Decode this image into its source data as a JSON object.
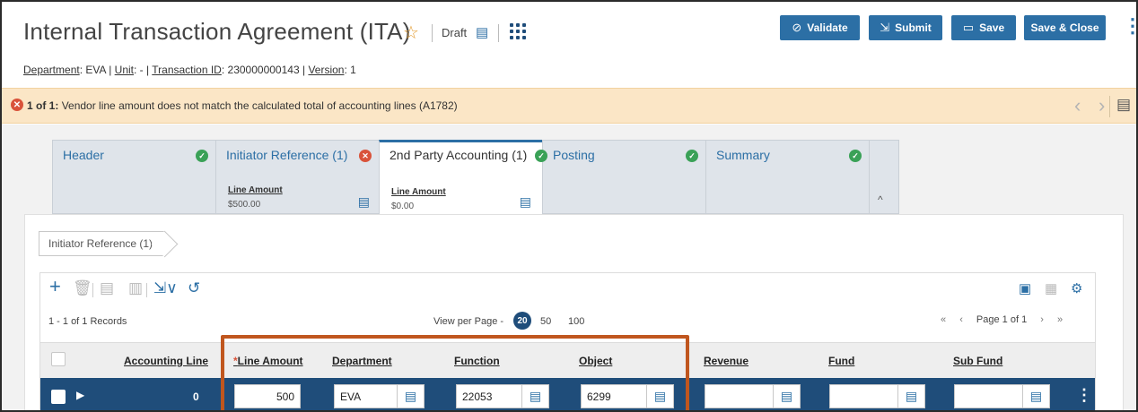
{
  "header": {
    "title": "Internal Transaction Agreement (ITA)",
    "status": "Draft",
    "meta": {
      "department_label": "Department",
      "department_value": ": EVA",
      "unit_label": "Unit",
      "unit_value": ": -",
      "transaction_label": "Transaction ID",
      "transaction_value": ": 230000000143",
      "version_label": "Version",
      "version_value": ": 1",
      "sep": "|"
    },
    "buttons": {
      "validate": "Validate",
      "submit": "Submit",
      "save": "Save",
      "save_close": "Save & Close"
    }
  },
  "alert": {
    "count": "1 of 1:",
    "message": "Vendor line amount does not match the calculated total of accounting lines (A1782)"
  },
  "tabs": [
    {
      "label": "Header",
      "status": "ok"
    },
    {
      "label": "Initiator Reference (1)",
      "status": "error",
      "sub_label": "Line Amount",
      "sub_value": "$500.00"
    },
    {
      "label": "2nd Party Accounting (1)",
      "status": "ok",
      "sub_label": "Line Amount",
      "sub_value": "$0.00"
    },
    {
      "label": "Posting",
      "status": "ok"
    },
    {
      "label": "Summary",
      "status": "ok"
    }
  ],
  "breadcrumb": "Initiator Reference (1)",
  "grid": {
    "records": "1 - 1 of 1 Records",
    "view_per_page_label": "View per Page -",
    "page_sizes": [
      "20",
      "50",
      "100"
    ],
    "page_label": "Page 1 of 1",
    "columns": {
      "accounting_line": "Accounting Line",
      "line_amount_req": "*",
      "line_amount": "Line Amount",
      "department": "Department",
      "function": "Function",
      "object": "Object",
      "revenue": "Revenue",
      "fund": "Fund",
      "sub_fund": "Sub Fund"
    },
    "row": {
      "accounting_line": "0",
      "line_amount": "500",
      "department": "EVA",
      "function": "22053",
      "object": "6299",
      "revenue": "",
      "fund": "",
      "sub_fund": ""
    }
  },
  "icons": {
    "star": "☆",
    "doc": "▤",
    "check": "✓",
    "error": "✕",
    "chev_left": "‹",
    "chev_right": "›",
    "chev_up": "^",
    "first": "«",
    "prev": "‹",
    "next": "›",
    "last": "»",
    "add": "+",
    "undo": "↺",
    "kebab": "⋮",
    "expand": "▶",
    "validate": "⊘",
    "submit": "⇲",
    "save": "▭",
    "lookup": "▤"
  },
  "colors": {
    "primary": "#2c6fa5",
    "row_selected": "#1f4d7a",
    "alert_bg": "#fbe6c6",
    "ok": "#3aa157",
    "error": "#d9533a",
    "highlight": "#c0561e"
  }
}
